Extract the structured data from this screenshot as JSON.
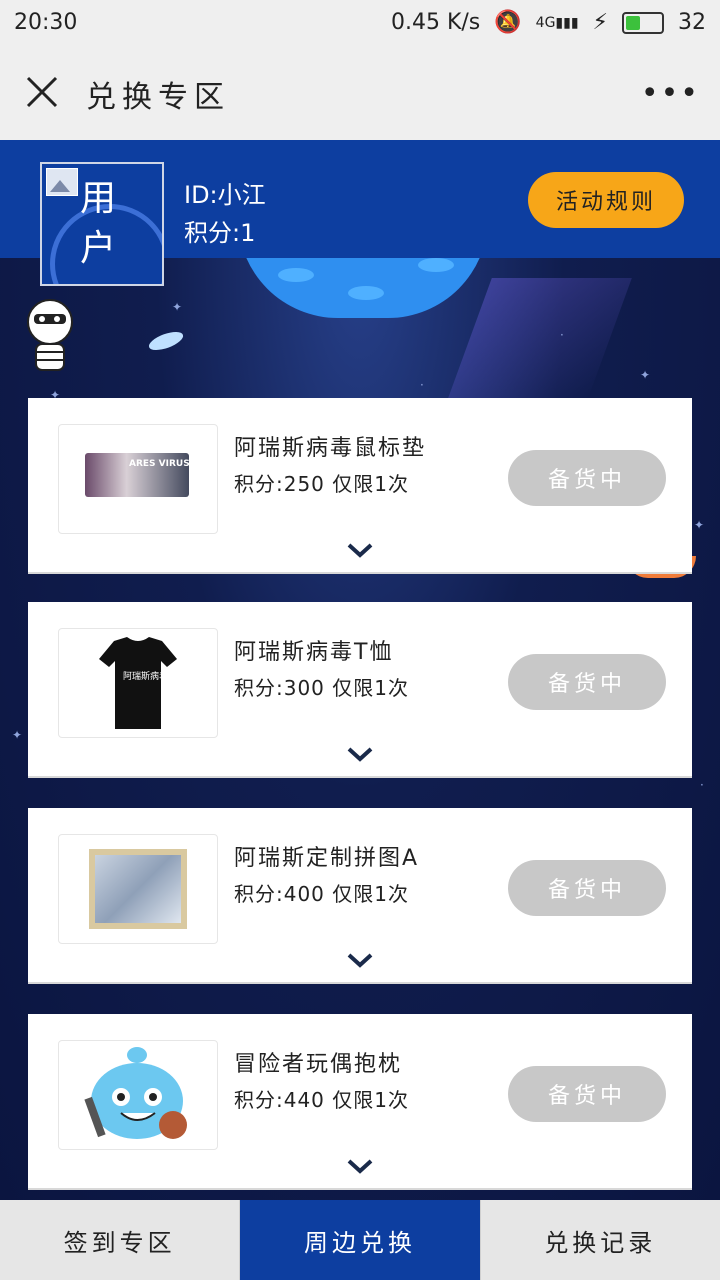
{
  "status_bar": {
    "time": "20:30",
    "net_speed": "0.45 K/s",
    "signal": "4G",
    "battery": "32"
  },
  "title_bar": {
    "title": "兑换专区",
    "more": "•••"
  },
  "user": {
    "avatar_label": "用户",
    "id_text": "ID:小江",
    "points_text": "积分:1"
  },
  "rules_button": "活动规则",
  "items": [
    {
      "name": "阿瑞斯病毒鼠标垫",
      "points": "积分:250 仅限1次",
      "status": "备货中",
      "image_text": "ARES VIRUS"
    },
    {
      "name": "阿瑞斯病毒T恤",
      "points": "积分:300 仅限1次",
      "status": "备货中",
      "image_text": "阿瑞斯病毒"
    },
    {
      "name": "阿瑞斯定制拼图A",
      "points": "积分:400 仅限1次",
      "status": "备货中",
      "image_text": ""
    },
    {
      "name": "冒险者玩偶抱枕",
      "points": "积分:440 仅限1次",
      "status": "备货中",
      "image_text": ""
    }
  ],
  "tabs": [
    {
      "label": "签到专区",
      "active": false
    },
    {
      "label": "周边兑换",
      "active": true
    },
    {
      "label": "兑换记录",
      "active": false
    }
  ]
}
